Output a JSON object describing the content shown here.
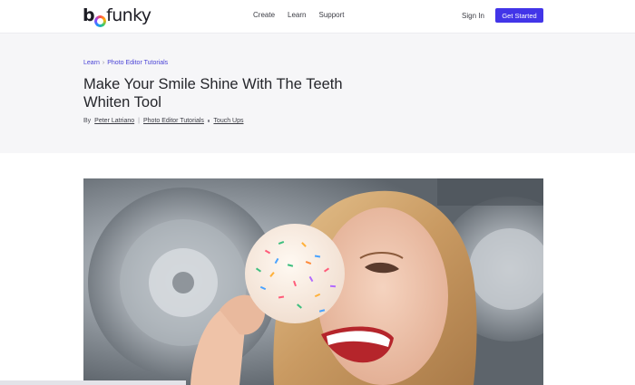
{
  "header": {
    "logo_text_b": "b",
    "logo_text_rest": "funky",
    "nav": [
      {
        "label": "Create"
      },
      {
        "label": "Learn"
      },
      {
        "label": "Support"
      }
    ],
    "sign_in": "Sign In",
    "cta": "Get Started",
    "accent_color": "#4235e8"
  },
  "breadcrumb": {
    "items": [
      "Learn",
      "Photo Editor Tutorials"
    ],
    "separator": "›"
  },
  "article": {
    "title": "Make Your Smile Shine With The Teeth Whiten Tool",
    "byline_prefix": "By",
    "author": "Peter Latriano",
    "categories": [
      "Photo Editor Tutorials",
      "Touch Ups"
    ]
  }
}
